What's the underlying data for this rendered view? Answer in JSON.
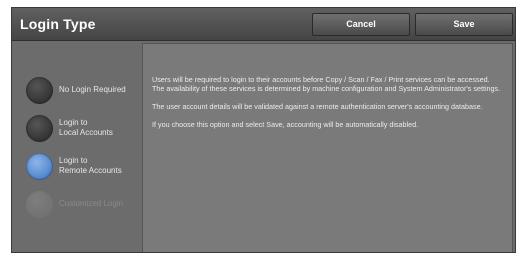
{
  "header": {
    "title": "Login Type",
    "cancel_label": "Cancel",
    "save_label": "Save"
  },
  "options": [
    {
      "label": "No Login Required",
      "selected": false,
      "disabled": false
    },
    {
      "label": "Login to\nLocal Accounts",
      "selected": false,
      "disabled": false
    },
    {
      "label": "Login to\nRemote Accounts",
      "selected": true,
      "disabled": false
    },
    {
      "label": "Customized Login",
      "selected": false,
      "disabled": true
    }
  ],
  "description": {
    "para1": "Users will be required to login to their accounts before Copy / Scan / Fax / Print services can be accessed.  The availability of these services is determined by machine configuration and System Administrator's settings.",
    "para2": "The user account details will be validated against a remote authentication server's accounting database.",
    "para3": "If you choose this option and select Save, accounting will be automatically disabled."
  },
  "colors": {
    "selected_radio": "#4f86cf",
    "header_bg": "#4f4f4f",
    "panel_bg": "#7a7a7a"
  }
}
